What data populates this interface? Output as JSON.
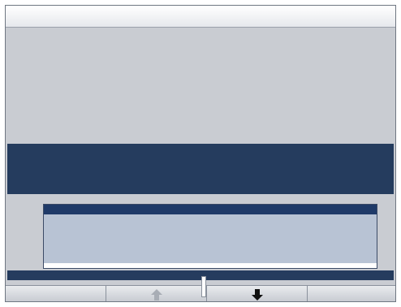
{
  "window": {
    "title": ""
  },
  "preview": {
    "text": ""
  },
  "prompt": {
    "text": ""
  },
  "list": {
    "items": [
      {
        "label": "",
        "selected": true
      },
      {
        "label": "",
        "selected": false
      },
      {
        "label": "",
        "selected": false
      },
      {
        "label": "",
        "selected": false
      },
      {
        "label": "",
        "selected": false
      },
      {
        "label": "",
        "selected": false
      }
    ]
  },
  "hint": {
    "text": ""
  },
  "toolbar": {
    "first_label": "",
    "up_icon": "arrow-up-icon",
    "up_enabled": false,
    "down_icon": "arrow-down-icon",
    "down_enabled": true,
    "last_label": ""
  },
  "colors": {
    "panel_background": "#c9ccd2",
    "prompt_background": "#253c5e",
    "list_selected": "#1f3a68",
    "list_row": "#b8c3d4"
  }
}
